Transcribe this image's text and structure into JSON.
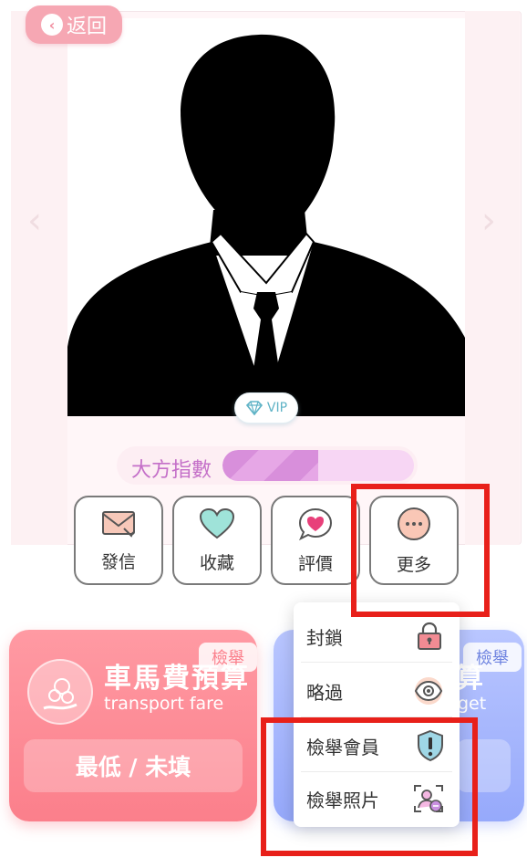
{
  "header": {
    "back_label": "返回"
  },
  "profile": {
    "vip_label": "VIP"
  },
  "generosity": {
    "label": "大方指數",
    "level": 0.5
  },
  "actions": [
    {
      "label": "發信",
      "icon": "envelope-icon"
    },
    {
      "label": "收藏",
      "icon": "heart-icon"
    },
    {
      "label": "評價",
      "icon": "heart-chat-icon"
    },
    {
      "label": "更多",
      "icon": "more-dots-icon"
    }
  ],
  "budget_left": {
    "title": "車馬費預算",
    "subtitle": "transport fare",
    "value": "最低 / 未填",
    "report_label": "檢舉"
  },
  "budget_right": {
    "title": "算",
    "subtitle": "get",
    "report_label": "檢舉"
  },
  "more_menu": {
    "items": [
      {
        "label": "封鎖",
        "icon": "lock-icon"
      },
      {
        "label": "略過",
        "icon": "eye-icon"
      },
      {
        "label": "檢舉會員",
        "icon": "shield-alert-icon"
      },
      {
        "label": "檢舉照片",
        "icon": "photo-report-icon"
      }
    ]
  },
  "colors": {
    "highlight": "#e8201a",
    "pink_card": "#fb7f8b",
    "blue_card": "#96a9fb",
    "index_fill": "#d88fdb"
  }
}
